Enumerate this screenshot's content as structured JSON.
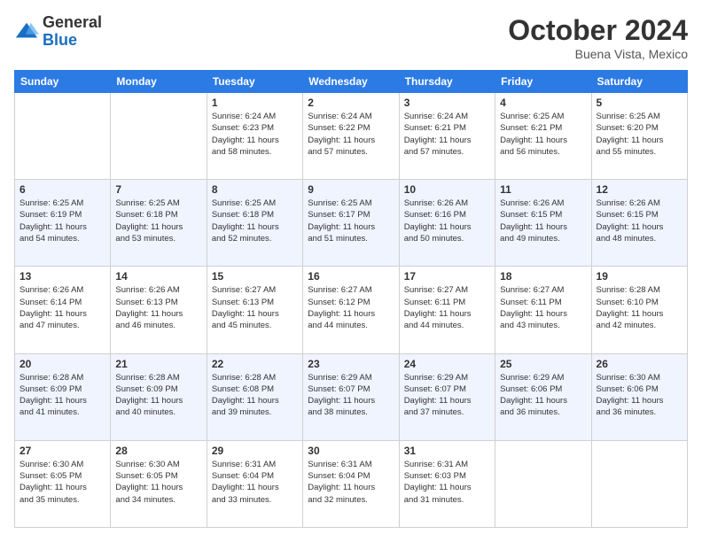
{
  "header": {
    "logo": {
      "general": "General",
      "blue": "Blue"
    },
    "title": "October 2024",
    "location": "Buena Vista, Mexico"
  },
  "weekdays": [
    "Sunday",
    "Monday",
    "Tuesday",
    "Wednesday",
    "Thursday",
    "Friday",
    "Saturday"
  ],
  "weeks": [
    [
      null,
      null,
      {
        "day": 1,
        "sunrise": "6:24 AM",
        "sunset": "6:23 PM",
        "daylight": "11 hours and 58 minutes."
      },
      {
        "day": 2,
        "sunrise": "6:24 AM",
        "sunset": "6:22 PM",
        "daylight": "11 hours and 57 minutes."
      },
      {
        "day": 3,
        "sunrise": "6:24 AM",
        "sunset": "6:21 PM",
        "daylight": "11 hours and 57 minutes."
      },
      {
        "day": 4,
        "sunrise": "6:25 AM",
        "sunset": "6:21 PM",
        "daylight": "11 hours and 56 minutes."
      },
      {
        "day": 5,
        "sunrise": "6:25 AM",
        "sunset": "6:20 PM",
        "daylight": "11 hours and 55 minutes."
      }
    ],
    [
      {
        "day": 6,
        "sunrise": "6:25 AM",
        "sunset": "6:19 PM",
        "daylight": "11 hours and 54 minutes."
      },
      {
        "day": 7,
        "sunrise": "6:25 AM",
        "sunset": "6:18 PM",
        "daylight": "11 hours and 53 minutes."
      },
      {
        "day": 8,
        "sunrise": "6:25 AM",
        "sunset": "6:18 PM",
        "daylight": "11 hours and 52 minutes."
      },
      {
        "day": 9,
        "sunrise": "6:25 AM",
        "sunset": "6:17 PM",
        "daylight": "11 hours and 51 minutes."
      },
      {
        "day": 10,
        "sunrise": "6:26 AM",
        "sunset": "6:16 PM",
        "daylight": "11 hours and 50 minutes."
      },
      {
        "day": 11,
        "sunrise": "6:26 AM",
        "sunset": "6:15 PM",
        "daylight": "11 hours and 49 minutes."
      },
      {
        "day": 12,
        "sunrise": "6:26 AM",
        "sunset": "6:15 PM",
        "daylight": "11 hours and 48 minutes."
      }
    ],
    [
      {
        "day": 13,
        "sunrise": "6:26 AM",
        "sunset": "6:14 PM",
        "daylight": "11 hours and 47 minutes."
      },
      {
        "day": 14,
        "sunrise": "6:26 AM",
        "sunset": "6:13 PM",
        "daylight": "11 hours and 46 minutes."
      },
      {
        "day": 15,
        "sunrise": "6:27 AM",
        "sunset": "6:13 PM",
        "daylight": "11 hours and 45 minutes."
      },
      {
        "day": 16,
        "sunrise": "6:27 AM",
        "sunset": "6:12 PM",
        "daylight": "11 hours and 44 minutes."
      },
      {
        "day": 17,
        "sunrise": "6:27 AM",
        "sunset": "6:11 PM",
        "daylight": "11 hours and 44 minutes."
      },
      {
        "day": 18,
        "sunrise": "6:27 AM",
        "sunset": "6:11 PM",
        "daylight": "11 hours and 43 minutes."
      },
      {
        "day": 19,
        "sunrise": "6:28 AM",
        "sunset": "6:10 PM",
        "daylight": "11 hours and 42 minutes."
      }
    ],
    [
      {
        "day": 20,
        "sunrise": "6:28 AM",
        "sunset": "6:09 PM",
        "daylight": "11 hours and 41 minutes."
      },
      {
        "day": 21,
        "sunrise": "6:28 AM",
        "sunset": "6:09 PM",
        "daylight": "11 hours and 40 minutes."
      },
      {
        "day": 22,
        "sunrise": "6:28 AM",
        "sunset": "6:08 PM",
        "daylight": "11 hours and 39 minutes."
      },
      {
        "day": 23,
        "sunrise": "6:29 AM",
        "sunset": "6:07 PM",
        "daylight": "11 hours and 38 minutes."
      },
      {
        "day": 24,
        "sunrise": "6:29 AM",
        "sunset": "6:07 PM",
        "daylight": "11 hours and 37 minutes."
      },
      {
        "day": 25,
        "sunrise": "6:29 AM",
        "sunset": "6:06 PM",
        "daylight": "11 hours and 36 minutes."
      },
      {
        "day": 26,
        "sunrise": "6:30 AM",
        "sunset": "6:06 PM",
        "daylight": "11 hours and 36 minutes."
      }
    ],
    [
      {
        "day": 27,
        "sunrise": "6:30 AM",
        "sunset": "6:05 PM",
        "daylight": "11 hours and 35 minutes."
      },
      {
        "day": 28,
        "sunrise": "6:30 AM",
        "sunset": "6:05 PM",
        "daylight": "11 hours and 34 minutes."
      },
      {
        "day": 29,
        "sunrise": "6:31 AM",
        "sunset": "6:04 PM",
        "daylight": "11 hours and 33 minutes."
      },
      {
        "day": 30,
        "sunrise": "6:31 AM",
        "sunset": "6:04 PM",
        "daylight": "11 hours and 32 minutes."
      },
      {
        "day": 31,
        "sunrise": "6:31 AM",
        "sunset": "6:03 PM",
        "daylight": "11 hours and 31 minutes."
      },
      null,
      null
    ]
  ],
  "labels": {
    "sunrise": "Sunrise:",
    "sunset": "Sunset:",
    "daylight": "Daylight:"
  }
}
